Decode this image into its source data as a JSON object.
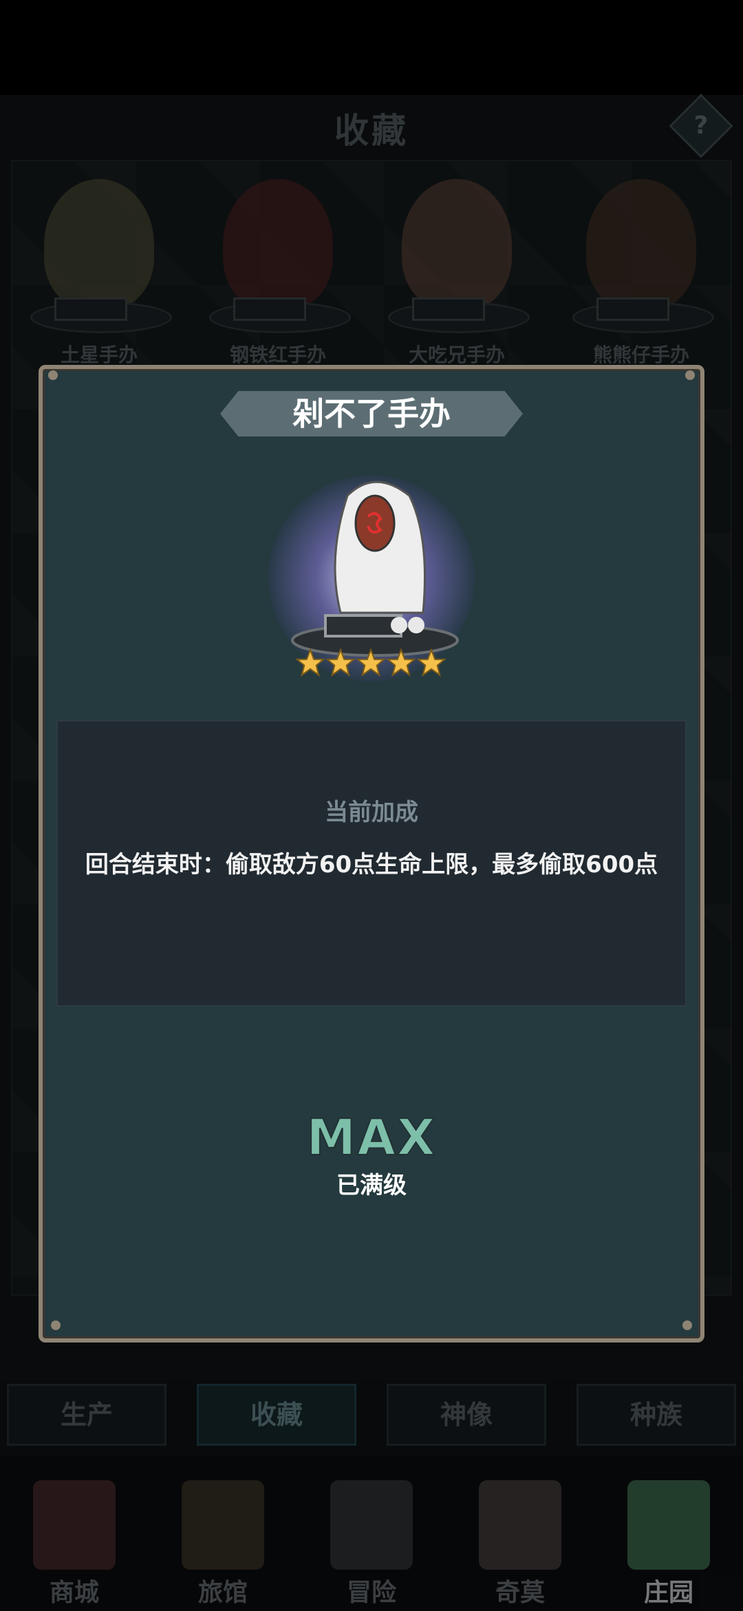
{
  "header": {
    "title": "收藏",
    "help_label": "?"
  },
  "collection_items": [
    {
      "label": "土星手办"
    },
    {
      "label": "钢铁红手办"
    },
    {
      "label": "大吃兄手办"
    },
    {
      "label": "熊熊仔手办"
    }
  ],
  "section_tabs": [
    {
      "label": "生产"
    },
    {
      "label": "收藏",
      "active": true
    },
    {
      "label": "神像"
    },
    {
      "label": "种族"
    }
  ],
  "bottom_nav": [
    {
      "label": "商城",
      "icon": "shop-icon"
    },
    {
      "label": "旅馆",
      "icon": "inn-icon"
    },
    {
      "label": "冒险",
      "icon": "crossed-swords-icon"
    },
    {
      "label": "奇莫",
      "icon": "creature-icon"
    },
    {
      "label": "庄园",
      "icon": "manor-island-icon"
    }
  ],
  "modal": {
    "title": "剁不了手办",
    "stars": 5,
    "bonus_title": "当前加成",
    "bonus_text": "回合结束时：偷取敌方60点生命上限，最多偷取600点",
    "level_label": "MAX",
    "level_sub": "已满级"
  },
  "colors": {
    "modal_bg": "#243a3e",
    "modal_border": "#8f8474",
    "max_color": "#7dbfa9",
    "star_color": "#f5c04a"
  }
}
